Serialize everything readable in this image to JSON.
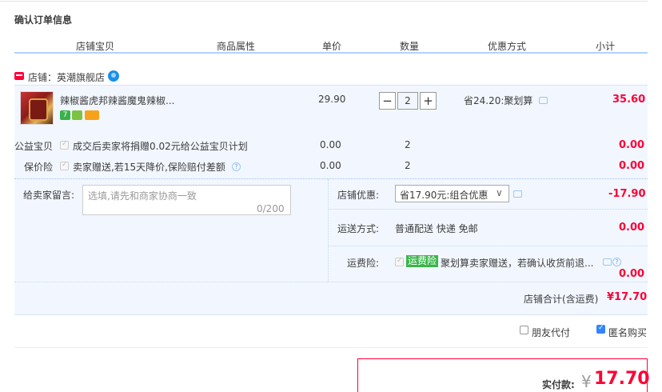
{
  "section_title": "确认订单信息",
  "headers": [
    "店铺宝贝",
    "商品属性",
    "单价",
    "数量",
    "优惠方式",
    "小计"
  ],
  "shop": {
    "label": "店铺：",
    "name": "英潮旗舰店"
  },
  "item": {
    "name": "辣椒酱虎邦辣酱魔鬼辣椒...",
    "badge1": "7",
    "price": "29.90",
    "quantity": "2",
    "minus": "−",
    "plus": "+",
    "discount": "省24.20:聚划算",
    "subtotal": "35.60"
  },
  "charity": {
    "label": "公益宝贝",
    "desc": "成交后卖家将捐赠0.02元给公益宝贝计划",
    "price": "0.00",
    "qty": "2",
    "subtotal": "0.00"
  },
  "insurance": {
    "label": "保价险",
    "desc": "卖家赠送,若15天降价,保险赔付差额",
    "price": "0.00",
    "qty": "2",
    "subtotal": "0.00"
  },
  "message": {
    "label": "给卖家留言:",
    "placeholder": "选填,请先和商家协商一致",
    "count": "0/200"
  },
  "shop_discount": {
    "label": "店铺优惠:",
    "value": "省17.90元:组合优惠",
    "amount": "-17.90"
  },
  "shipping": {
    "label": "运送方式:",
    "value": "普通配送 快递 免邮",
    "amount": "0.00"
  },
  "freight_insurance": {
    "label": "运费险:",
    "tag": "运费险",
    "desc": "聚划算卖家赠送，若确认收货前退...",
    "amount": "0.00"
  },
  "shop_total": {
    "label": "店铺合计(含运费)",
    "amount": "¥17.70"
  },
  "options": {
    "friend_pay": "朋友代付",
    "anonymous": "匿名购买"
  },
  "pay": {
    "label": "实付款:",
    "yen": "¥",
    "amount": "17.70"
  },
  "colors": {
    "accent_red": "#ff0036",
    "header_line": "#b2d1ff",
    "row_bg": "#f2f7ff"
  },
  "icons": [
    "shop-icon",
    "wangwang-icon",
    "chat-icon",
    "help-icon",
    "chevron-down-icon"
  ]
}
